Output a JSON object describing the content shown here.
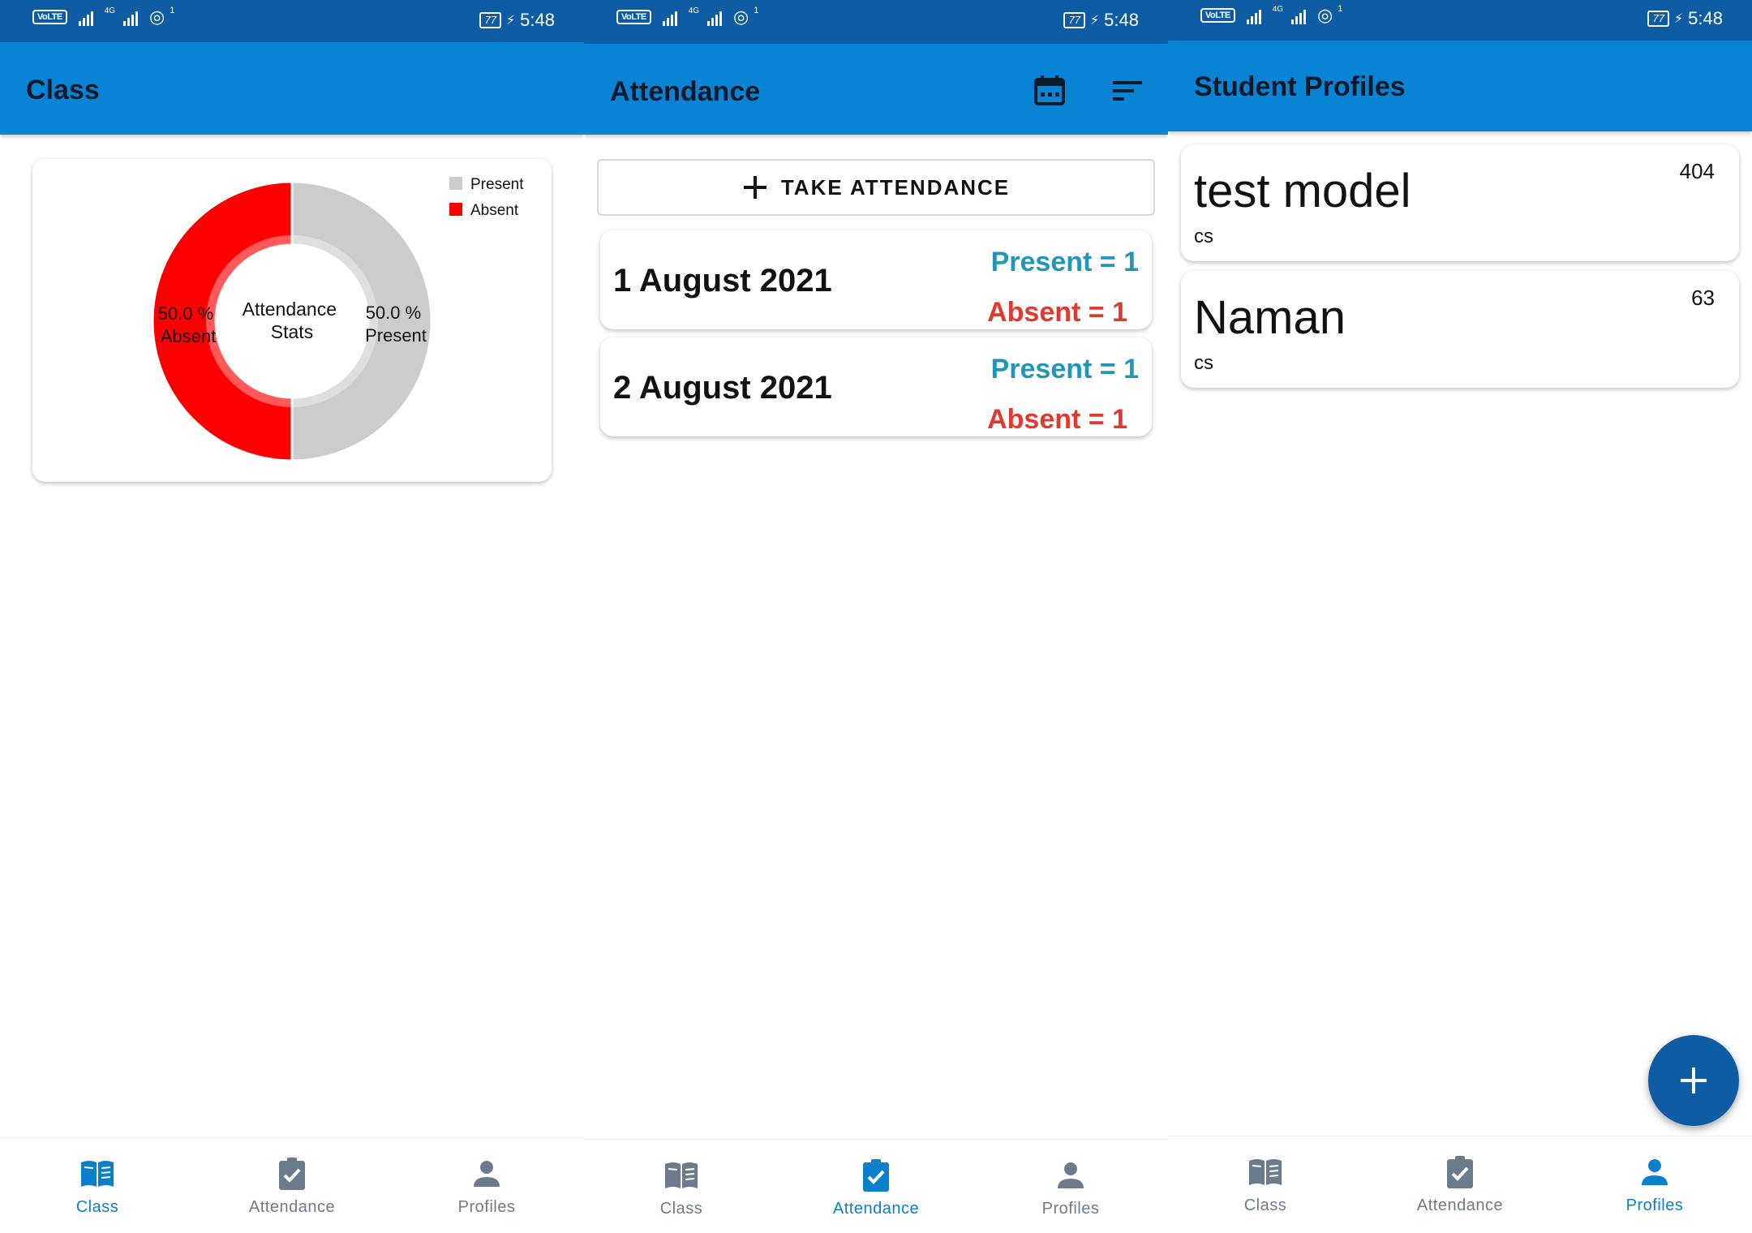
{
  "status_bar": {
    "volte": "VoLTE",
    "network": "4G",
    "hotspot_count": "1",
    "battery": "77",
    "time": "5:48"
  },
  "screens": {
    "class": {
      "title": "Class",
      "chart_title": "Attendance Stats",
      "legend": [
        "Present",
        "Absent"
      ],
      "slice_present_label": "50.0 % Present",
      "slice_absent_label": "50.0 % Absent",
      "slice_present_pct": "50.0 %",
      "slice_present_name": "Present",
      "slice_absent_pct": "50.0 %",
      "slice_absent_name": "Absent"
    },
    "attendance": {
      "title": "Attendance",
      "take_button": "TAKE ATTENDANCE",
      "records": [
        {
          "date": "1 August 2021",
          "present": "Present = 1",
          "absent": "Absent = 1"
        },
        {
          "date": "2 August 2021",
          "present": "Present = 1",
          "absent": "Absent = 1"
        }
      ]
    },
    "profiles": {
      "title": "Student Profiles",
      "students": [
        {
          "name": "test model",
          "dept": "cs",
          "roll": "404"
        },
        {
          "name": "Naman",
          "dept": "cs",
          "roll": "63"
        }
      ]
    }
  },
  "nav": {
    "class": "Class",
    "attendance": "Attendance",
    "profiles": "Profiles"
  },
  "colors": {
    "statusbar": "#0d5ca4",
    "appbar": "#0984d4",
    "present": "#cccccc",
    "absent": "#ff0000",
    "present_text": "#2196b8",
    "absent_text": "#e0392f",
    "nav_active": "#0a7fcc",
    "nav_inactive": "#6b7b8c",
    "fab": "#0d5ca4"
  },
  "chart_data": {
    "type": "pie",
    "categories": [
      "Present",
      "Absent"
    ],
    "values": [
      50.0,
      50.0
    ],
    "title": "Attendance Stats",
    "legend_placement": "top-right"
  },
  "icons": {
    "calendar": "calendar-icon",
    "sort": "sort-icon",
    "plus": "plus-icon",
    "book": "book-icon",
    "clipboard": "clipboard-check-icon",
    "person": "person-icon"
  }
}
